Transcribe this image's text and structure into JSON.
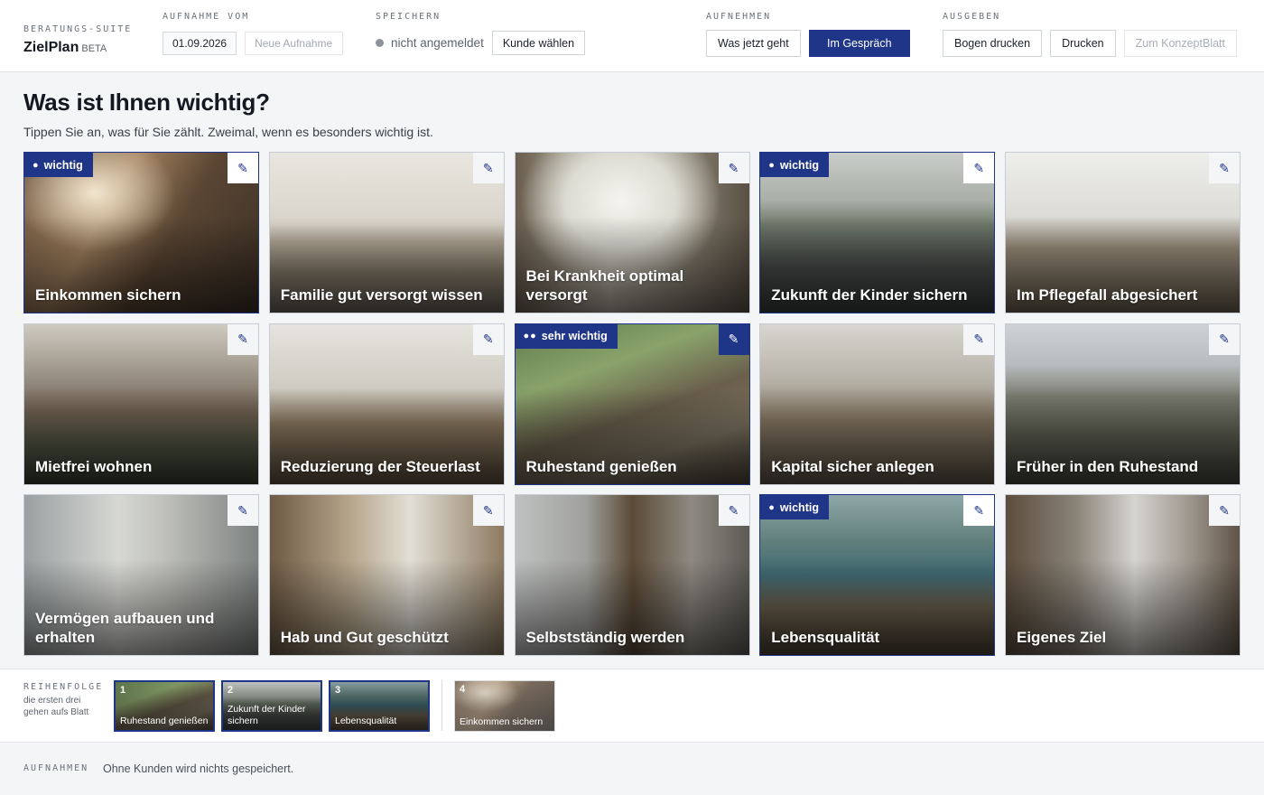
{
  "header": {
    "suite": "BERATUNGS-SUITE",
    "app": "ZielPlan",
    "beta": "BETA",
    "recording": {
      "title": "AUFNAHME VOM",
      "date": "01.09.2026",
      "new_placeholder": "Neue Aufnahme"
    },
    "save": {
      "title": "SPEICHERN",
      "status": "nicht angemeldet",
      "choose_client": "Kunde wählen"
    },
    "capture": {
      "title": "AUFNEHMEN",
      "now": "Was jetzt geht",
      "in_talk": "Im Gespräch"
    },
    "output": {
      "title": "AUSGEBEN",
      "print_sheet": "Bogen drucken",
      "print": "Drucken",
      "concept": "Zum KonzeptBlatt"
    }
  },
  "page": {
    "title": "Was ist Ihnen wichtig?",
    "subtitle": "Tippen Sie an, was für Sie zählt. Zweimal, wenn es besonders wichtig ist."
  },
  "cards": [
    {
      "label": "Einkommen sichern",
      "badge": "wichtig",
      "dots": "●",
      "level": 1,
      "scene": "workshop"
    },
    {
      "label": "Familie gut versorgt wissen",
      "badge": "",
      "dots": "",
      "level": 0,
      "scene": "living"
    },
    {
      "label": "Bei Krankheit optimal versorgt",
      "badge": "",
      "dots": "",
      "level": 0,
      "scene": "window"
    },
    {
      "label": "Zukunft der Kinder sichern",
      "badge": "wichtig",
      "dots": "●",
      "level": 1,
      "scene": "street"
    },
    {
      "label": "Im Pflegefall abgesichert",
      "badge": "",
      "dots": "",
      "level": 0,
      "scene": "kitchen"
    },
    {
      "label": "Mietfrei wohnen",
      "badge": "",
      "dots": "",
      "level": 0,
      "scene": "garden"
    },
    {
      "label": "Reduzierung der Steuerlast",
      "badge": "",
      "dots": "",
      "level": 0,
      "scene": "desk"
    },
    {
      "label": "Ruhestand genießen",
      "badge": "sehr wichtig",
      "dots": "●●",
      "level": 2,
      "scene": "terrace"
    },
    {
      "label": "Kapital sicher anlegen",
      "badge": "",
      "dots": "",
      "level": 0,
      "scene": "table"
    },
    {
      "label": "Früher in den Ruhestand",
      "badge": "",
      "dots": "",
      "level": 0,
      "scene": "field"
    },
    {
      "label": "Vermögen aufbauen und erhalten",
      "badge": "",
      "dots": "",
      "level": 0,
      "scene": "room"
    },
    {
      "label": "Hab und Gut geschützt",
      "badge": "",
      "dots": "",
      "level": 0,
      "scene": "hall"
    },
    {
      "label": "Selbstständig werden",
      "badge": "",
      "dots": "",
      "level": 0,
      "scene": "door"
    },
    {
      "label": "Lebensqualität",
      "badge": "wichtig",
      "dots": "●",
      "level": 1,
      "scene": "lake"
    },
    {
      "label": "Eigenes Ziel",
      "badge": "",
      "dots": "",
      "level": 0,
      "scene": "study"
    }
  ],
  "edit_icon": "pencil-icon",
  "order": {
    "title": "REIHENFOLGE",
    "hint": "die ersten drei gehen aufs Blatt",
    "items": [
      {
        "num": "1",
        "label": "Ruhestand genießen",
        "scene": "terrace",
        "muted": false
      },
      {
        "num": "2",
        "label": "Zukunft der Kinder sichern",
        "scene": "street",
        "muted": false
      },
      {
        "num": "3",
        "label": "Lebensqualität",
        "scene": "lake",
        "muted": false
      },
      {
        "num": "4",
        "label": "Einkommen sichern",
        "scene": "workshop",
        "muted": true
      }
    ]
  },
  "footer": {
    "title": "AUFNAHMEN",
    "message": "Ohne Kunden wird nichts gespeichert."
  },
  "colors": {
    "accent": "#1f3587",
    "background": "#f4f5f7",
    "border": "#c7ccd4"
  }
}
